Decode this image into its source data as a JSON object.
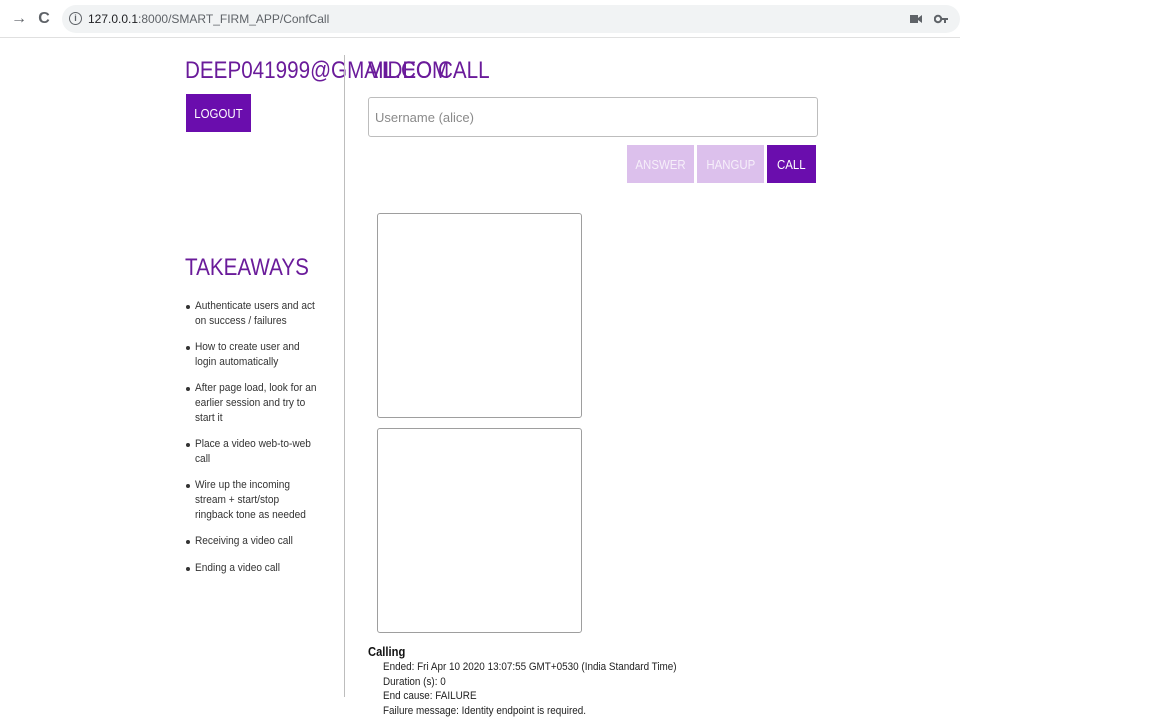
{
  "browser": {
    "url_host": "127.0.0.1",
    "url_rest": ":8000/SMART_FIRM_APP/ConfCall",
    "icons": [
      "forward-icon",
      "reload-icon",
      "info-icon",
      "camera-icon",
      "key-icon"
    ]
  },
  "sidebar": {
    "user_email": "DEEP041999@GMAIL.COM",
    "logout_label": "LOGOUT",
    "takeaways_title": "TAKEAWAYS",
    "takeaways": [
      "Authenticate users and act on success / failures",
      "How to create user and login automatically",
      "After page load, look for an earlier session and try to start it",
      "Place a video web-to-web call",
      "Wire up the incoming stream + start/stop ringback tone as needed",
      "Receiving a video call",
      "Ending a video call"
    ]
  },
  "main": {
    "title": "VIDEO CALL",
    "username_placeholder": "Username (alice)",
    "buttons": {
      "answer": "ANSWER",
      "hangup": "HANGUP",
      "call": "CALL"
    },
    "status": {
      "title": "Calling",
      "ended": "Ended: Fri Apr 10 2020 13:07:55 GMT+0530 (India Standard Time)",
      "duration": "Duration (s): 0",
      "end_cause": "End cause: FAILURE",
      "failure_message": "Failure message: Identity endpoint is required."
    }
  },
  "colors": {
    "accent": "#6a0dad",
    "accent_disabled": "#dcc0ec",
    "title_purple": "#6a1b9a"
  }
}
